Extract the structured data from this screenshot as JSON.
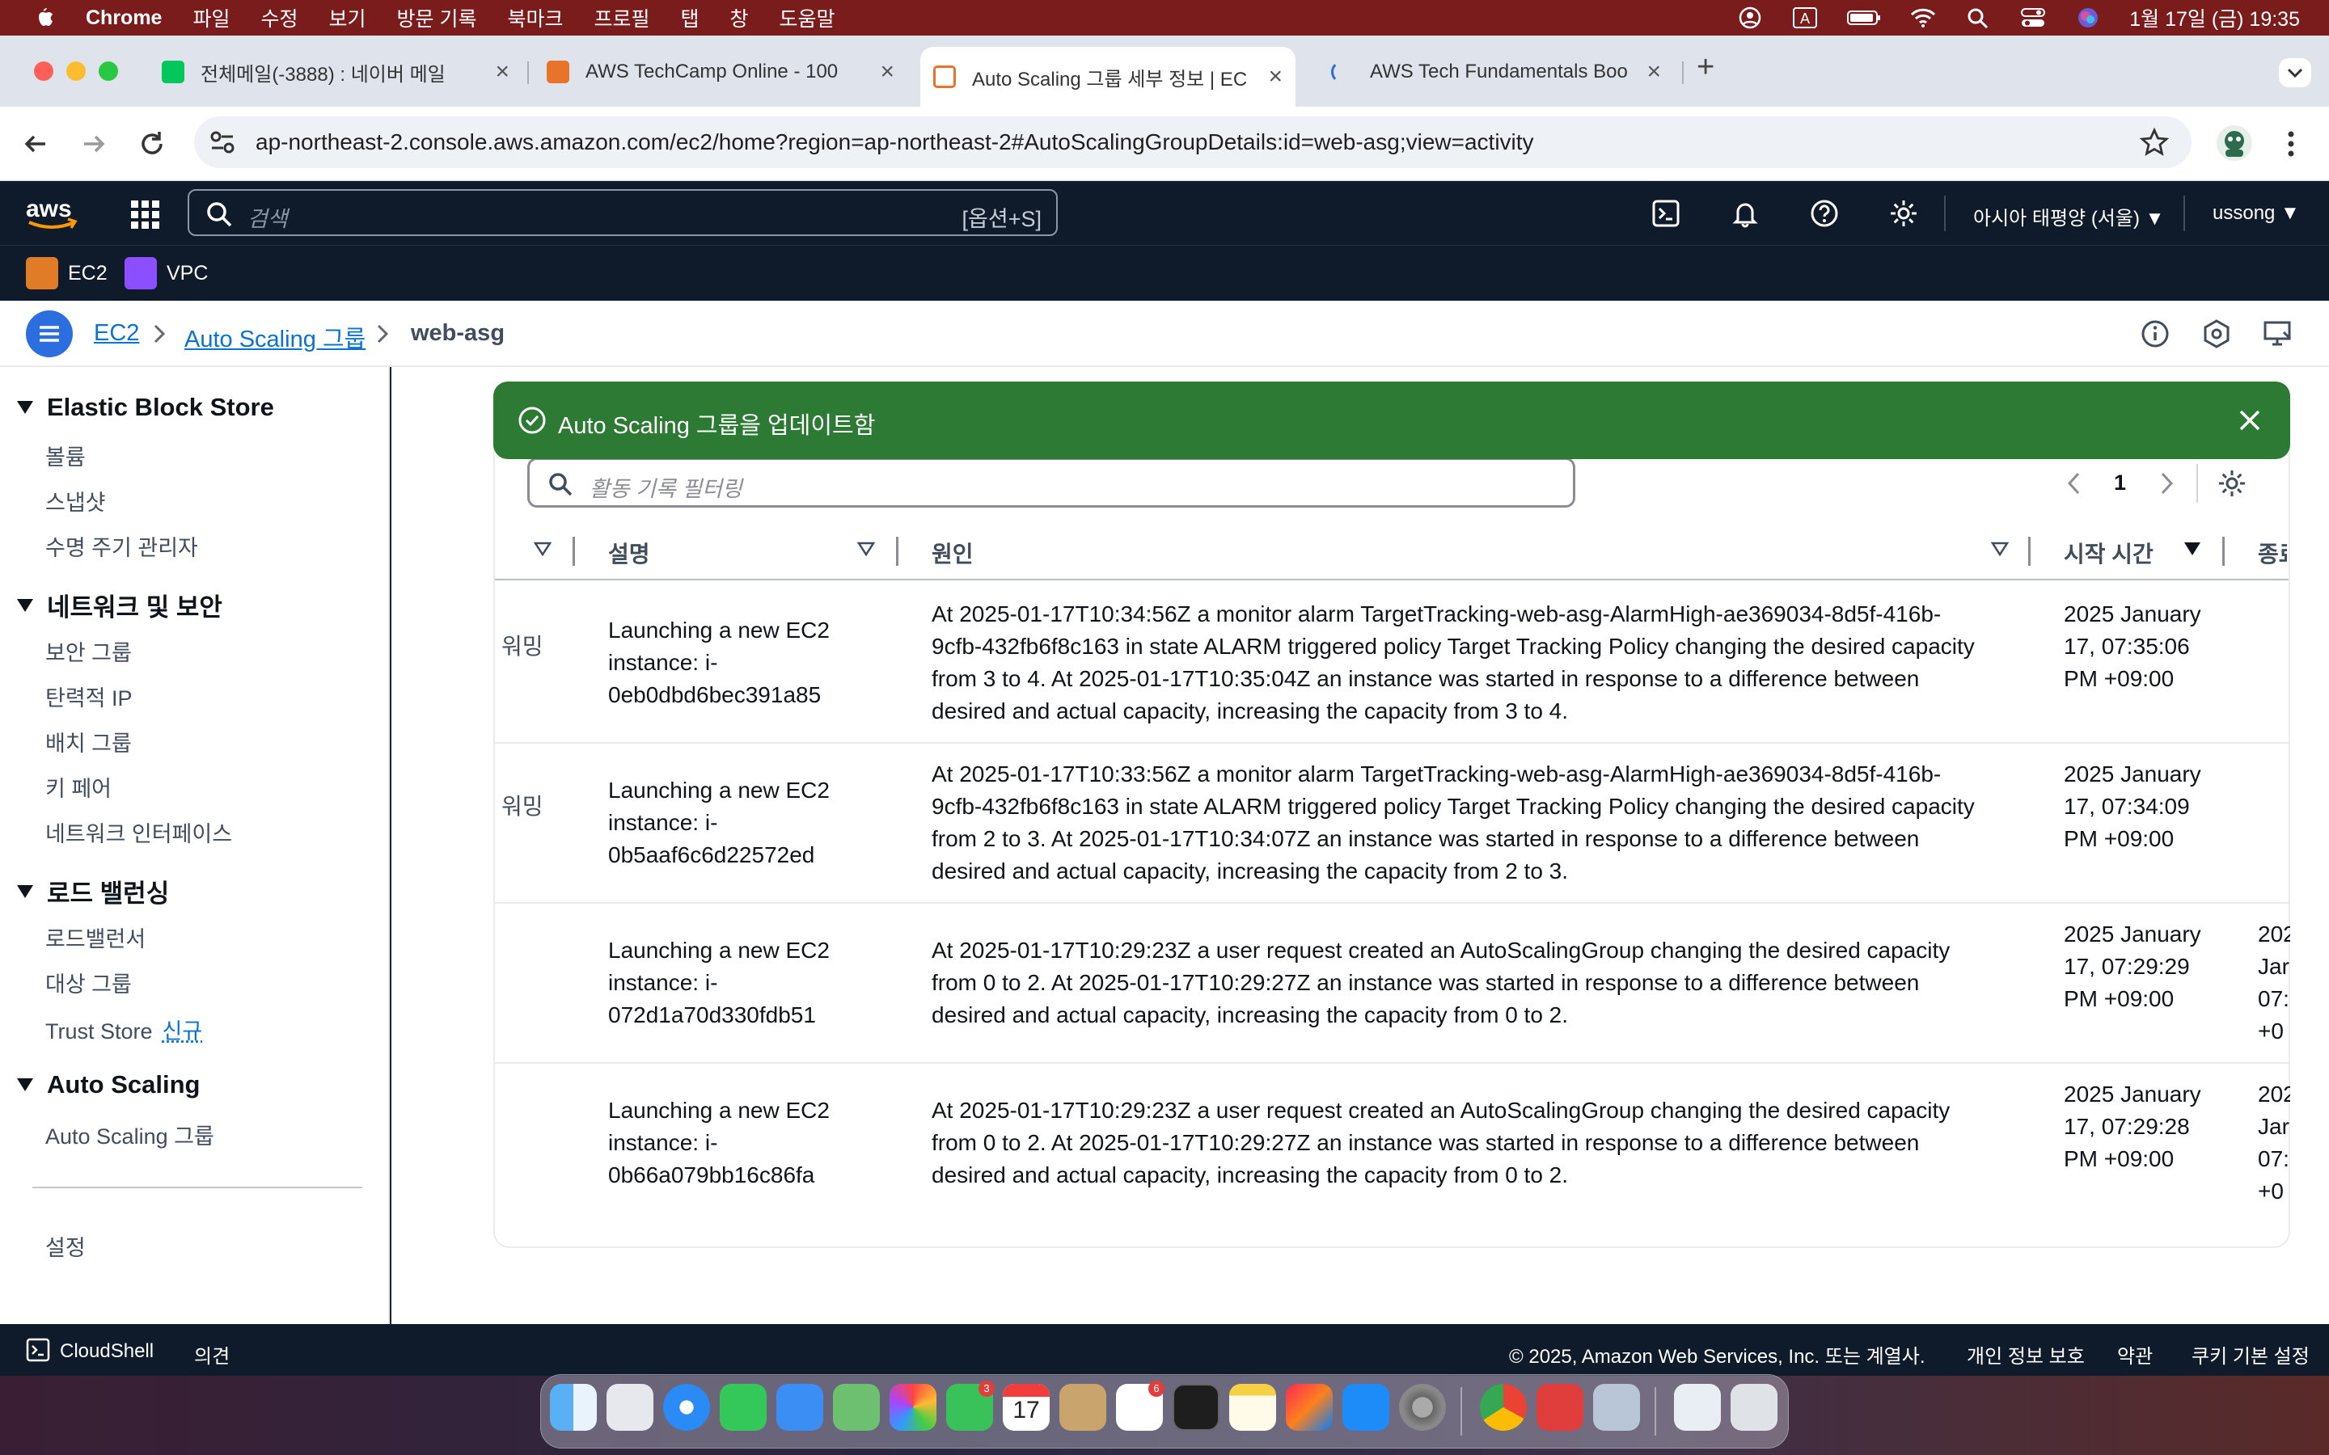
{
  "menubar": {
    "app_name": "Chrome",
    "menus": [
      "파일",
      "수정",
      "보기",
      "방문 기록",
      "북마크",
      "프로필",
      "탭",
      "창",
      "도움말"
    ],
    "clock": "1월 17일 (금) 19:35"
  },
  "browser": {
    "tabs": [
      {
        "label": "전체메일(-3888) : 네이버 메일",
        "favicon_color": "#03c75a"
      },
      {
        "label": "AWS TechCamp Online - 100",
        "favicon_color": "#e8742b"
      },
      {
        "label": "Auto Scaling 그룹 세부 정보 | EC",
        "favicon_color": "#e8742b"
      },
      {
        "label": "AWS Tech Fundamentals Boo",
        "favicon_color": "#2b6cd6"
      }
    ],
    "url": "ap-northeast-2.console.aws.amazon.com/ec2/home?region=ap-northeast-2#AutoScalingGroupDetails:id=web-asg;view=activity"
  },
  "aws_header": {
    "search_placeholder": "검색",
    "search_shortcut": "[옵션+S]",
    "region": "아시아 태평양 (서울)",
    "user": "ussong",
    "favorites": [
      "EC2",
      "VPC"
    ]
  },
  "breadcrumb": {
    "items": [
      "EC2",
      "Auto Scaling 그룹",
      "web-asg"
    ]
  },
  "sidenav": {
    "sections": [
      {
        "title": "Elastic Block Store",
        "links": [
          "볼륨",
          "스냅샷",
          "수명 주기 관리자"
        ]
      },
      {
        "title": "네트워크 및 보안",
        "links": [
          "보안 그룹",
          "탄력적 IP",
          "배치 그룹",
          "키 페어",
          "네트워크 인터페이스"
        ]
      },
      {
        "title": "로드 밸런싱",
        "links": [
          "로드밸런서",
          "대상 그룹",
          "Trust Store"
        ]
      },
      {
        "title": "Auto Scaling",
        "links": [
          "Auto Scaling 그룹"
        ]
      }
    ],
    "new_badge": "신규",
    "settings": "설정"
  },
  "flash": {
    "message": "Auto Scaling 그룹을 업데이트함",
    "color": "#2c7a33"
  },
  "activity": {
    "filter_placeholder": "활동 기록 필터링",
    "page": "1",
    "columns": {
      "description": "설명",
      "cause": "원인",
      "start_time": "시작 시간",
      "end_time_partial": "종료"
    },
    "rows": [
      {
        "status": "워밍",
        "description": "Launching a new EC2 instance: i-0eb0dbd6bec391a85",
        "cause": "At 2025-01-17T10:34:56Z a monitor alarm TargetTracking-web-asg-AlarmHigh-ae369034-8d5f-416b-9cfb-432fb6f8c163 in state ALARM triggered policy Target Tracking Policy changing the desired capacity from 3 to 4. At 2025-01-17T10:35:04Z an instance was started in response to a difference between desired and actual capacity, increasing the capacity from 3 to 4.",
        "start": "2025 January 17, 07:35:06 PM +09:00",
        "end": ""
      },
      {
        "status": "워밍",
        "description": "Launching a new EC2 instance: i-0b5aaf6c6d22572ed",
        "cause": "At 2025-01-17T10:33:56Z a monitor alarm TargetTracking-web-asg-AlarmHigh-ae369034-8d5f-416b-9cfb-432fb6f8c163 in state ALARM triggered policy Target Tracking Policy changing the desired capacity from 2 to 3. At 2025-01-17T10:34:07Z an instance was started in response to a difference between desired and actual capacity, increasing the capacity from 2 to 3.",
        "start": "2025 January 17, 07:34:09 PM +09:00",
        "end": ""
      },
      {
        "status": "",
        "description": "Launching a new EC2 instance: i-072d1a70d330fdb51",
        "cause": "At 2025-01-17T10:29:23Z a user request created an AutoScalingGroup changing the desired capacity from 0 to 2. At 2025-01-17T10:29:27Z an instance was started in response to a difference between desired and actual capacity, increasing the capacity from 0 to 2.",
        "start": "2025 January 17, 07:29:29 PM +09:00",
        "end": "202 Jar 07: +0"
      },
      {
        "status": "",
        "description": "Launching a new EC2 instance: i-0b66a079bb16c86fa",
        "cause": "At 2025-01-17T10:29:23Z a user request created an AutoScalingGroup changing the desired capacity from 0 to 2. At 2025-01-17T10:29:27Z an instance was started in response to a difference between desired and actual capacity, increasing the capacity from 0 to 2.",
        "start": "2025 January 17, 07:29:28 PM +09:00",
        "end": "202 Jar 07: +0"
      }
    ]
  },
  "footer": {
    "cloudshell": "CloudShell",
    "feedback": "의견",
    "copyright": "© 2025, Amazon Web Services, Inc. 또는 계열사.",
    "privacy": "개인 정보 보호",
    "terms": "약관",
    "cookies": "쿠키 기본 설정"
  },
  "dock": {
    "badges": [
      "3",
      "6"
    ],
    "calendar_day": "17"
  }
}
